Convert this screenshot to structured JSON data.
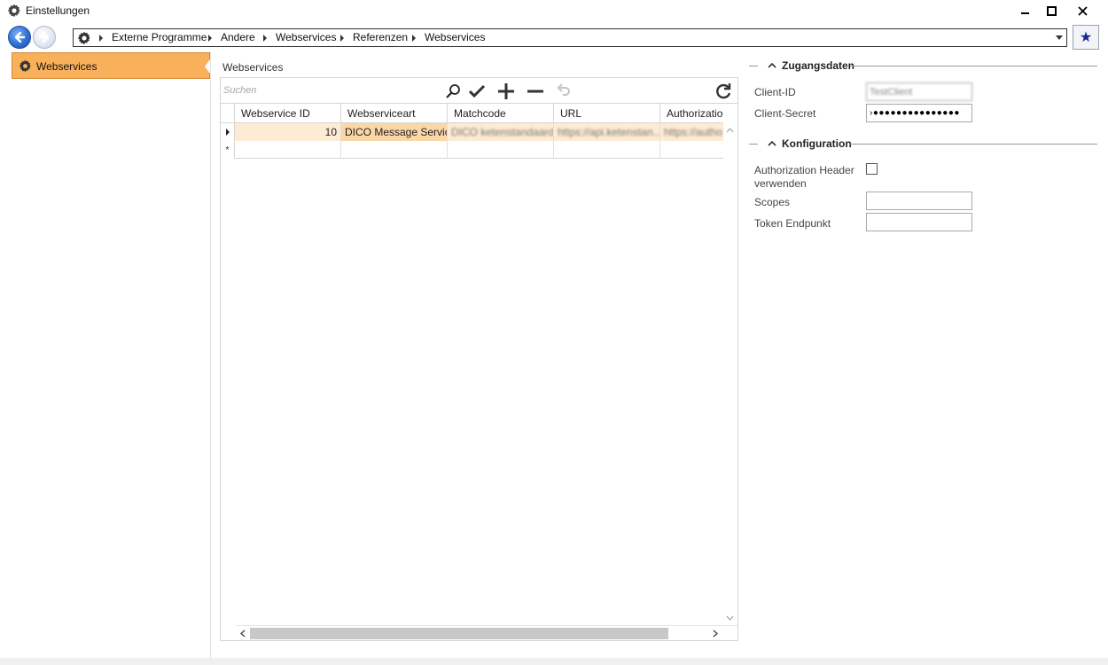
{
  "window": {
    "title": "Einstellungen",
    "minimize": "‒",
    "maximize": "□",
    "close": "✕"
  },
  "nav": {
    "breadcrumb": [
      "Externe Programme",
      "Andere",
      "Webservices",
      "Referenzen",
      "Webservices"
    ],
    "favorite": "★"
  },
  "sidebar": {
    "items": [
      {
        "label": "Webservices",
        "selected": true
      }
    ]
  },
  "main": {
    "title": "Webservices",
    "search_placeholder": "Suchen",
    "columns": [
      "Webservice ID",
      "Webserviceart",
      "Matchcode",
      "URL",
      "Authorization"
    ],
    "rows": [
      {
        "webservice_id": "10",
        "webserviceart": "DICO Message Service",
        "matchcode": "DICO ketenstandaard",
        "url": "https://api.ketenstan...",
        "authorization": "https://autho"
      }
    ],
    "new_row_marker": "*"
  },
  "details": {
    "section_access": "Zugangsdaten",
    "client_id_label": "Client-ID",
    "client_id_value": "TestClient",
    "client_secret_label": "Client-Secret",
    "client_secret_value": "›●●●●●●●●●●●●●●●",
    "section_config": "Konfiguration",
    "auth_header_label_1": "Authorization Header",
    "auth_header_label_2": "verwenden",
    "auth_header_checked": false,
    "scopes_label": "Scopes",
    "scopes_value": "",
    "token_endpoint_label": "Token Endpunkt",
    "token_endpoint_value": ""
  },
  "colors": {
    "selection_orange": "#f9b05a",
    "row_highlight": "#fdebd3",
    "nav_blue": "#2e6fd3"
  }
}
